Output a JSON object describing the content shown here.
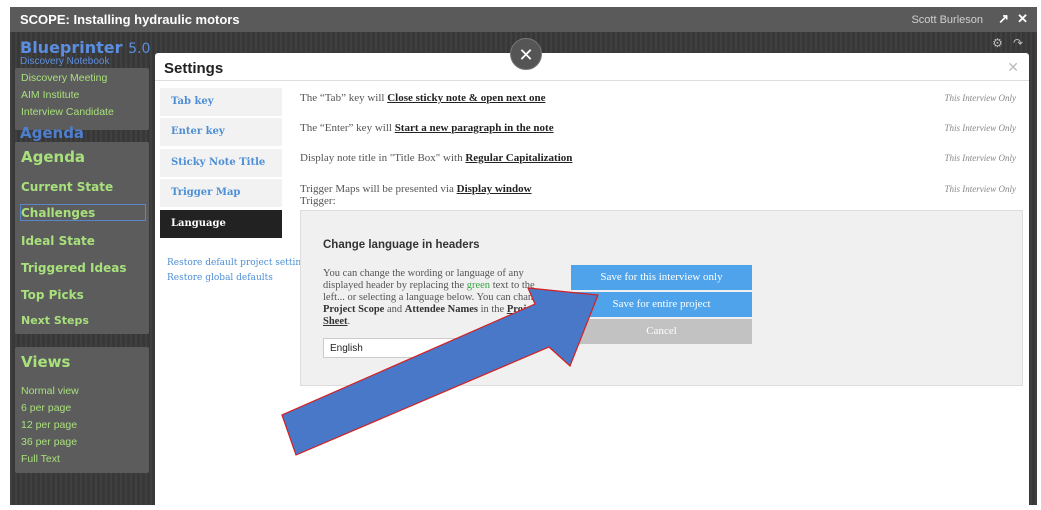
{
  "titlebar": {
    "title": "SCOPE: Installing hydraulic motors",
    "user": "Scott Burleson",
    "popout_icon": "popout-icon",
    "close_icon": "close-icon"
  },
  "board": {
    "brand": "Blueprinter",
    "version": "5.0",
    "brand_sub": "Discovery Notebook",
    "meeting": [
      "Discovery Meeting",
      "AIM Institute",
      "Interview Candidate"
    ],
    "agenda_bg": "Agenda",
    "agenda": {
      "heading": "Agenda",
      "items": [
        "Current State",
        "Challenges",
        "Ideal State",
        "Triggered Ideas",
        "Top Picks",
        "Next Steps"
      ]
    },
    "views": {
      "heading": "Views",
      "items": [
        "Normal view",
        "6 per page",
        "12 per page",
        "36 per page",
        "Full Text"
      ]
    }
  },
  "settings": {
    "title": "Settings",
    "tabs": [
      "Tab key",
      "Enter key",
      "Sticky Note Title Box",
      "Trigger Map",
      "Language"
    ],
    "restore": [
      "Restore default project settings",
      "Restore global defaults"
    ],
    "rows": [
      {
        "prefix": "The “Tab” key will ",
        "value": "Close sticky note & open next one",
        "scope": "This Interview Only"
      },
      {
        "prefix": "The “Enter” key will ",
        "value": "Start a new paragraph in the note",
        "scope": "This Interview Only"
      },
      {
        "prefix": "Display note title in \"Title Box\" with ",
        "value": "Regular Capitalization",
        "scope": "This Interview Only"
      },
      {
        "prefix": "Trigger Maps will be presented via ",
        "value": "Display window",
        "scope": "This Interview Only",
        "sub": "Trigger:"
      }
    ],
    "language": {
      "heading": "Change language in headers",
      "desc_1": "You can change the wording or language of any displayed header by replacing the ",
      "desc_green": "green",
      "desc_2": " text to the left... or selecting a language below. You can change the ",
      "desc_b1": "Project Scope",
      "desc_3": " and ",
      "desc_b2": "Attendee Names",
      "desc_4": " in the ",
      "desc_bu": "Project Sheet",
      "desc_5": ".",
      "selected": "English"
    },
    "buttons": {
      "interview": "Save for this interview only",
      "project": "Save for entire project",
      "cancel": "Cancel"
    }
  }
}
